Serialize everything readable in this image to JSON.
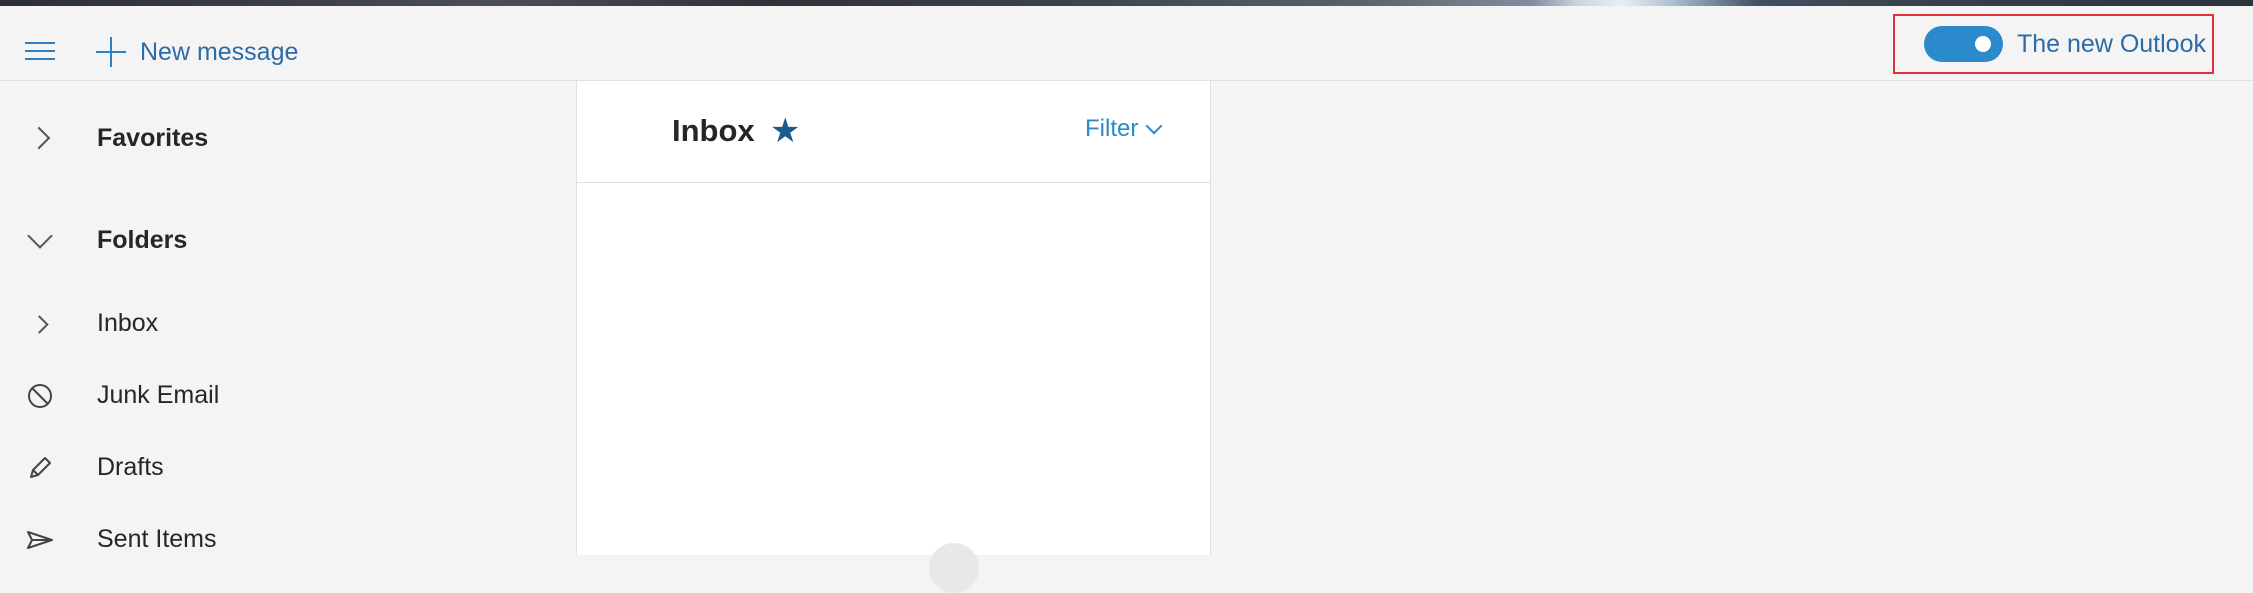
{
  "header": {
    "new_message_label": "New message",
    "toggle_label": "The new Outlook",
    "toggle_on": true
  },
  "sidebar": {
    "favorites_label": "Favorites",
    "folders_label": "Folders",
    "items": [
      {
        "label": "Inbox",
        "icon": "chevron-right-icon"
      },
      {
        "label": "Junk Email",
        "icon": "prohibited-icon"
      },
      {
        "label": "Drafts",
        "icon": "pencil-icon"
      },
      {
        "label": "Sent Items",
        "icon": "send-icon"
      }
    ]
  },
  "list": {
    "title": "Inbox",
    "star_glyph": "★",
    "filter_label": "Filter"
  },
  "colors": {
    "accent": "#2b8acb",
    "highlight_border": "#e03138"
  }
}
